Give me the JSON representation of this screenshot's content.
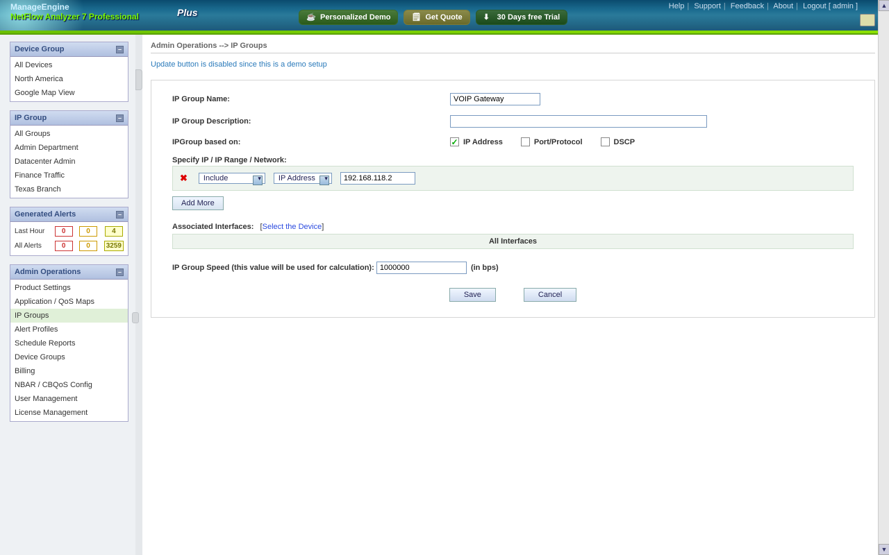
{
  "header": {
    "brand_top": "ManageEngine",
    "brand_bottom": "NetFlow Analyzer 7 Professional",
    "plus_badge": "Plus",
    "buttons": {
      "demo": "Personalized Demo",
      "quote": "Get Quote",
      "trial": "30 Days free Trial"
    },
    "links": {
      "help": "Help",
      "support": "Support",
      "feedback": "Feedback",
      "about": "About",
      "logout": "Logout",
      "user": "[ admin ]"
    }
  },
  "sidebar": {
    "device_group": {
      "title": "Device Group",
      "items": [
        "All Devices",
        "North America",
        "Google Map View"
      ]
    },
    "ip_group": {
      "title": "IP Group",
      "items": [
        "All Groups",
        "Admin Department",
        "Datacenter Admin",
        "Finance Traffic",
        "Texas Branch"
      ]
    },
    "alerts": {
      "title": "Generated Alerts",
      "rows": [
        {
          "label": "Last Hour",
          "red": "0",
          "orange": "0",
          "yellow": "4"
        },
        {
          "label": "All Alerts",
          "red": "0",
          "orange": "0",
          "yellow": "3259"
        }
      ]
    },
    "admin_ops": {
      "title": "Admin Operations",
      "items": [
        "Product Settings",
        "Application / QoS Maps",
        "IP Groups",
        "Alert Profiles",
        "Schedule Reports",
        "Device Groups",
        "Billing",
        "NBAR / CBQoS Config",
        "User Management",
        "License Management"
      ],
      "active_index": 2
    }
  },
  "main": {
    "breadcrumb": "Admin Operations --> IP Groups",
    "demo_note": "Update button is disabled since this is a demo setup",
    "labels": {
      "name": "IP Group Name:",
      "desc": "IP Group Description:",
      "based_on": "IPGroup based on:",
      "specify": "Specify IP / IP Range / Network:",
      "assoc": "Associated Interfaces:",
      "select_device": "Select the Device",
      "all_if": "All Interfaces",
      "speed": "IP Group Speed (this value will be used for calculation):",
      "bps": "(in bps)",
      "add_more": "Add More",
      "save": "Save",
      "cancel": "Cancel"
    },
    "values": {
      "name": "VOIP Gateway",
      "desc": "",
      "chk_ip": true,
      "chk_port": false,
      "chk_dscp": false,
      "opt_ip": "IP Address",
      "opt_port": "Port/Protocol",
      "opt_dscp": "DSCP",
      "rule_mode": "Include",
      "rule_type": "IP Address",
      "rule_value": "192.168.118.2",
      "speed": "1000000"
    }
  }
}
